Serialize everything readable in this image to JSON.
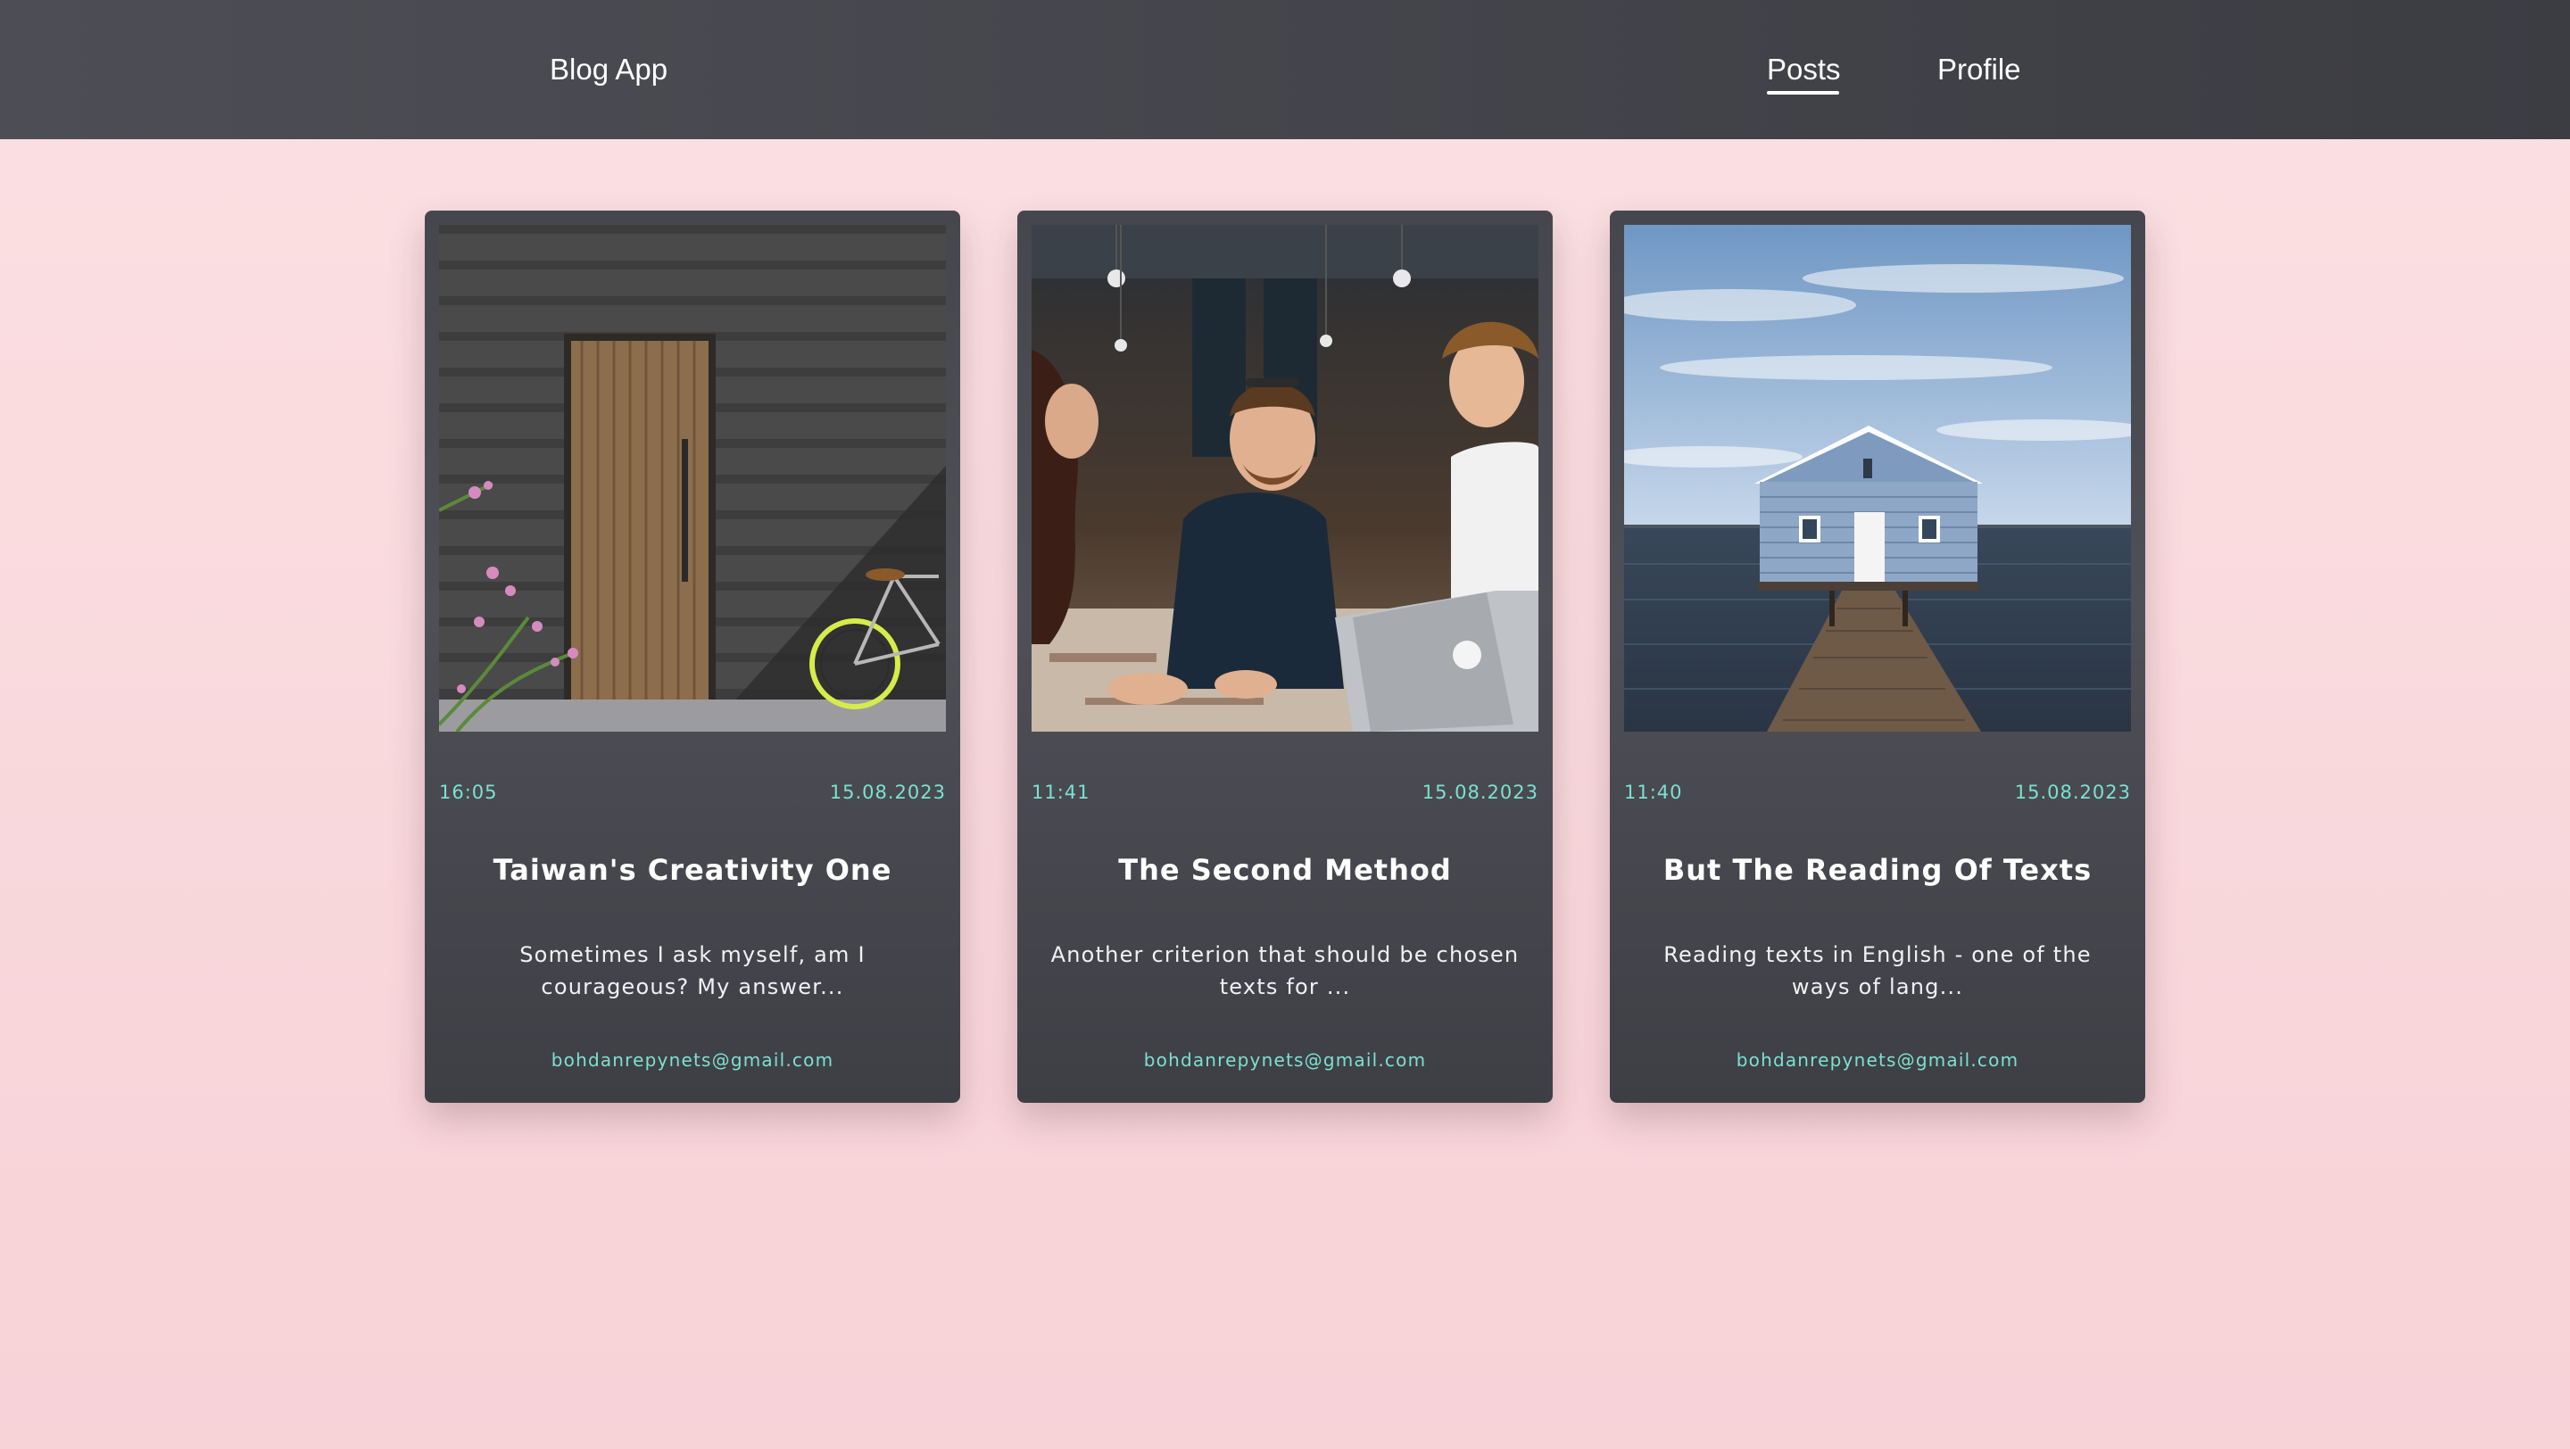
{
  "navbar": {
    "brand": "Blog App",
    "links": [
      {
        "label": "Posts",
        "active": true
      },
      {
        "label": "Profile",
        "active": false
      }
    ]
  },
  "colors": {
    "accent": "#7be1d2",
    "navbar": "#46474e",
    "card": "#4a4b52",
    "background": "#f9d9dc"
  },
  "posts": [
    {
      "image": "wooden-door-with-bicycle-photo",
      "time": "16:05",
      "date": "15.08.2023",
      "title": "Taiwan's Creativity One",
      "excerpt": "Sometimes I ask myself, am I courageous? My answer...",
      "author": "bohdanrepynets@gmail.com"
    },
    {
      "image": "people-at-laptop-photo",
      "time": "11:41",
      "date": "15.08.2023",
      "title": "The Second Method",
      "excerpt": "Another criterion that should be chosen texts for ...",
      "author": "bohdanrepynets@gmail.com"
    },
    {
      "image": "boathouse-on-pier-photo",
      "time": "11:40",
      "date": "15.08.2023",
      "title": "But The Reading Of Texts",
      "excerpt": "Reading texts in English - one of the ways of lang...",
      "author": "bohdanrepynets@gmail.com"
    }
  ]
}
